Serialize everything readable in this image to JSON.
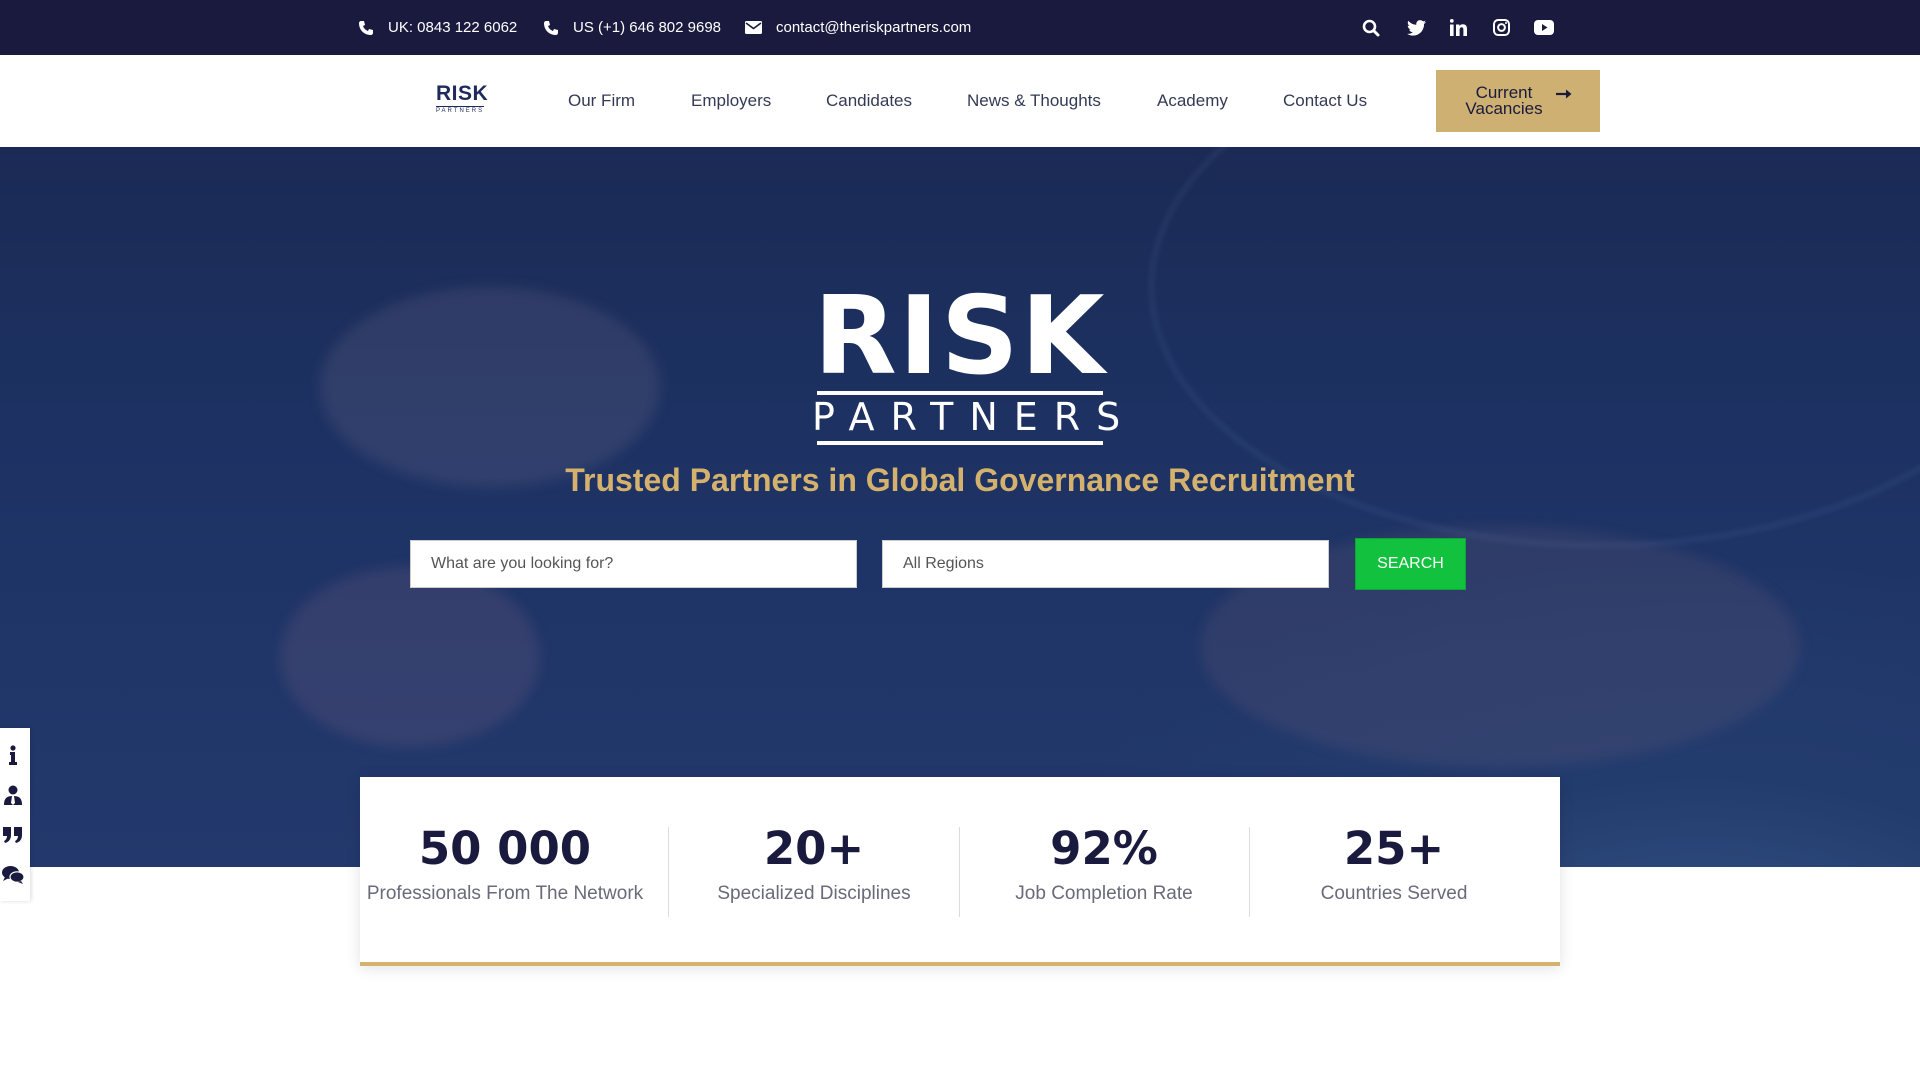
{
  "topbar": {
    "phone_uk": "UK: 0843 122 6062",
    "phone_us": "US (+1) 646 802 9698",
    "email": "contact@theriskpartners.com",
    "social": [
      "search-icon",
      "twitter-icon",
      "linkedin-icon",
      "instagram-icon",
      "youtube-icon"
    ]
  },
  "header": {
    "logo_word": "RISK",
    "logo_sub": "PARTNERS",
    "nav": [
      "Our Firm",
      "Employers",
      "Candidates",
      "News & Thoughts",
      "Academy",
      "Contact Us"
    ],
    "cta_label": "Current Vacancies"
  },
  "hero": {
    "logo_word": "RISK",
    "logo_sub": "PARTNERS",
    "tagline": "Trusted Partners in Global Governance Recruitment",
    "search_placeholder": "What are you looking for?",
    "region_placeholder": "All Regions",
    "search_button": "SEARCH"
  },
  "side_icons": [
    "info-icon",
    "user-tie-icon",
    "quote-icon",
    "chat-icon"
  ],
  "stats": [
    {
      "value": "50 000",
      "label": "Professionals From The Network"
    },
    {
      "value": "20+",
      "label": "Specialized Disciplines"
    },
    {
      "value": "92%",
      "label": "Job Completion Rate"
    },
    {
      "value": "25+",
      "label": "Countries Served"
    }
  ],
  "colors": {
    "topbar_bg": "#1a1a3e",
    "accent_gold": "#cdb072",
    "search_green": "#12c23e",
    "text_navy": "#1a1a3e"
  }
}
